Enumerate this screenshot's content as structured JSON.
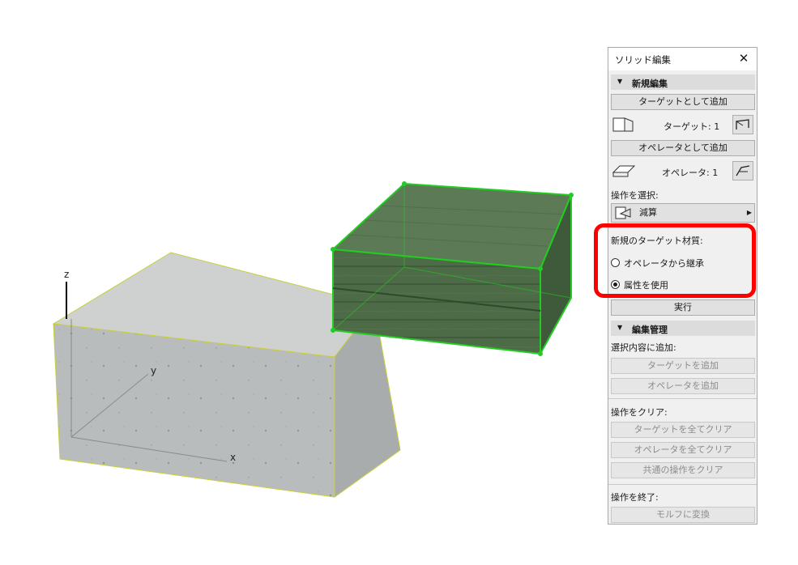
{
  "axes": {
    "z": "z",
    "y": "y",
    "x": "x"
  },
  "panel": {
    "title": "ソリッド編集",
    "close_icon": "close-icon",
    "section_new": "新規編集",
    "add_target_button": "ターゲットとして追加",
    "target_count": "ターゲット: 1",
    "add_operator_button": "オペレータとして追加",
    "operator_count": "オペレータ: 1",
    "select_operation_label": "操作を選択:",
    "operation_value": "減算",
    "new_target_material_label": "新規のターゲット材質:",
    "radio_inherit": "オペレータから継承",
    "radio_attribute": "属性を使用",
    "radio_selected": "radio_attribute",
    "execute_button": "実行",
    "section_manage": "編集管理",
    "add_to_selection_label": "選択内容に追加:",
    "add_target": "ターゲットを追加",
    "add_operator": "オペレータを追加",
    "clear_operation_label": "操作をクリア:",
    "clear_all_targets": "ターゲットを全てクリア",
    "clear_all_operators": "オペレータを全てクリア",
    "clear_common": "共通の操作をクリア",
    "finish_operation_label": "操作を終了:",
    "convert_to_morph": "モルフに変換"
  },
  "colors": {
    "highlight": "#ff0000",
    "selection": "#22cc22",
    "concrete_edge": "#c8cf3a"
  }
}
